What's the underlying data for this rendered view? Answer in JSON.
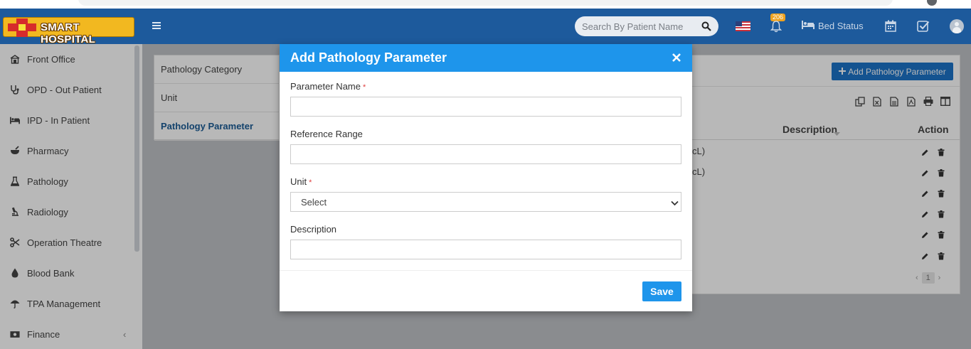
{
  "header": {
    "logo_text": "SMART HOSPITAL",
    "search_placeholder": "Search By Patient Name",
    "notification_count": "206",
    "bed_status_label": "Bed Status"
  },
  "sidebar": {
    "items": [
      {
        "label": "Front Office",
        "icon": "front-office-icon"
      },
      {
        "label": "OPD - Out Patient",
        "icon": "stethoscope-icon"
      },
      {
        "label": "IPD - In Patient",
        "icon": "bed-icon"
      },
      {
        "label": "Pharmacy",
        "icon": "mortar-icon"
      },
      {
        "label": "Pathology",
        "icon": "flask-icon"
      },
      {
        "label": "Radiology",
        "icon": "microscope-icon"
      },
      {
        "label": "Operation Theatre",
        "icon": "scissors-icon"
      },
      {
        "label": "Blood Bank",
        "icon": "drop-icon"
      },
      {
        "label": "TPA Management",
        "icon": "umbrella-icon"
      },
      {
        "label": "Finance",
        "icon": "money-icon"
      }
    ]
  },
  "submenu": {
    "items": [
      "Pathology Category",
      "Unit",
      "Pathology Parameter"
    ],
    "active_index": 2
  },
  "main": {
    "add_button_label": "Add Pathology Parameter",
    "columns": {
      "description": "Description",
      "action": "Action"
    },
    "row_fragments": [
      "cL)",
      "cL)"
    ],
    "row_count": 6,
    "pager": {
      "prev": "‹",
      "current": "1",
      "next": "›"
    }
  },
  "modal": {
    "title": "Add Pathology Parameter",
    "close_glyph": "×",
    "fields": {
      "parameter_name": {
        "label": "Parameter Name",
        "required_mark": "*",
        "value": ""
      },
      "reference_range": {
        "label": "Reference Range",
        "value": ""
      },
      "unit": {
        "label": "Unit",
        "required_mark": "*",
        "selected": "Select"
      },
      "description": {
        "label": "Description",
        "value": ""
      }
    },
    "save_label": "Save"
  },
  "colors": {
    "header_bg": "#1d5a9c",
    "modal_header_bg": "#1e95eb",
    "primary_button": "#1d74c8",
    "active_link": "#1b5c96",
    "required": "#e04040",
    "badge": "#f0a320"
  }
}
